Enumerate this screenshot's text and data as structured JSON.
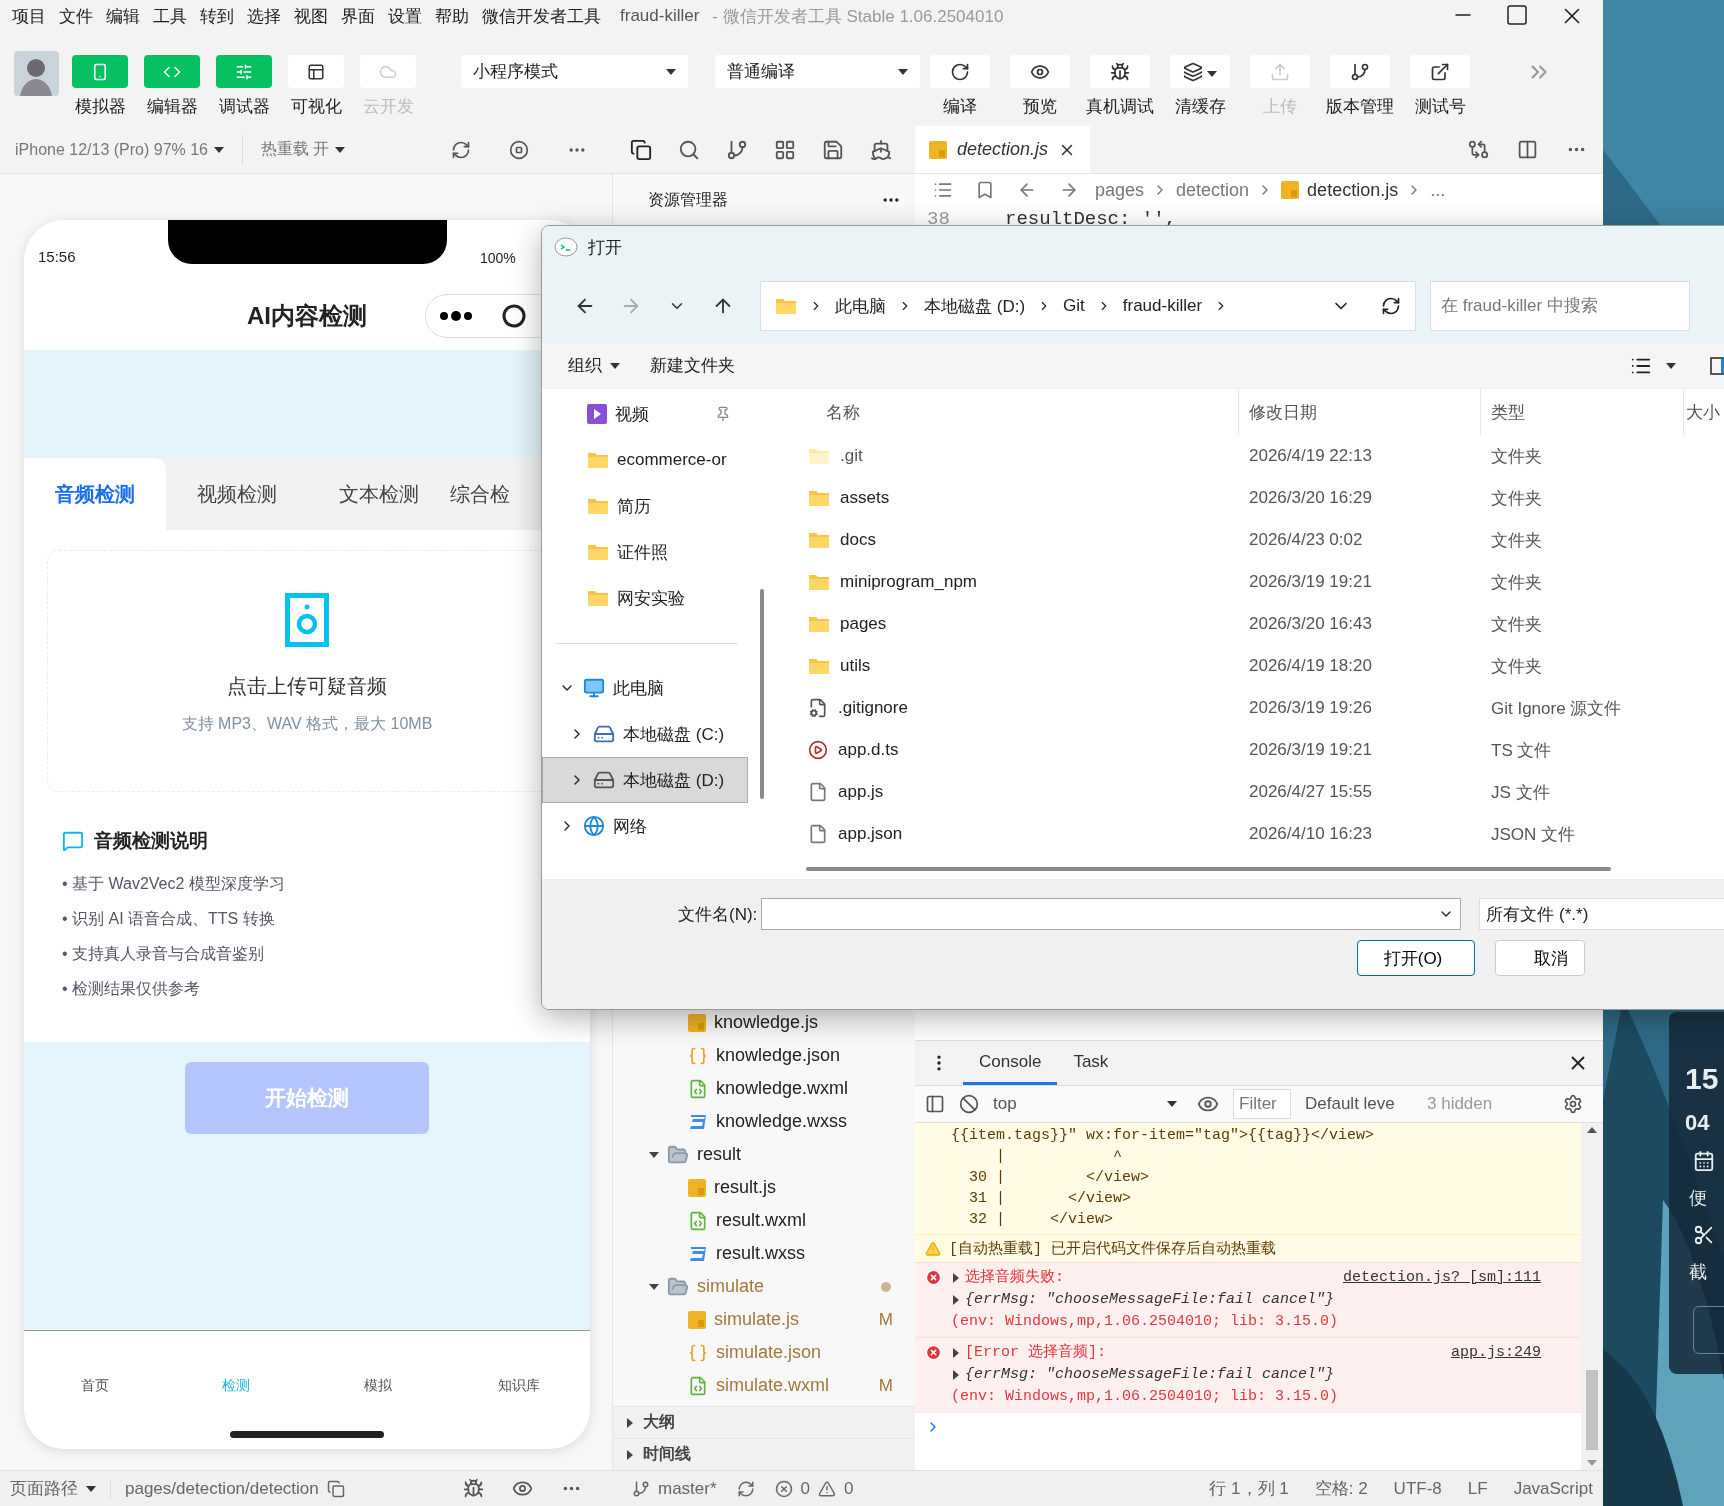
{
  "menu_bar": {
    "items": [
      "项目",
      "文件",
      "编辑",
      "工具",
      "转到",
      "选择",
      "视图",
      "界面",
      "设置",
      "帮助",
      "微信开发者工具"
    ],
    "title": "fraud-killer",
    "subtitle": "- 微信开发者工具 Stable 1.06.2504010"
  },
  "toolbar": {
    "view_buttons": [
      {
        "label": "模拟器",
        "on": true,
        "disabled": false
      },
      {
        "label": "编辑器",
        "on": true,
        "disabled": false
      },
      {
        "label": "调试器",
        "on": true,
        "disabled": false
      },
      {
        "label": "可视化",
        "on": false,
        "disabled": false
      },
      {
        "label": "云开发",
        "on": false,
        "disabled": true
      }
    ],
    "mode_select": "小程序模式",
    "compile_select": "普通编译",
    "actions": [
      {
        "label": "编译",
        "disabled": false
      },
      {
        "label": "预览",
        "disabled": false
      },
      {
        "label": "真机调试",
        "disabled": false
      },
      {
        "label": "清缓存",
        "disabled": false
      },
      {
        "label": "上传",
        "disabled": true
      },
      {
        "label": "版本管理",
        "disabled": false
      },
      {
        "label": "测试号",
        "disabled": false
      }
    ]
  },
  "simulator_bar": {
    "device": "iPhone 12/13 (Pro) 97% 16",
    "hot_reload": "热重载 开"
  },
  "editor": {
    "tab": "detection.js",
    "breadcrumb": [
      "pages",
      "detection",
      "detection.js",
      "..."
    ],
    "line_number": "38",
    "code": "resultDesc: '',"
  },
  "explorer": {
    "title": "资源管理器",
    "tree": [
      {
        "children": [
          {
            "name": "knowledge.js",
            "kind": "js",
            "modified": false
          },
          {
            "name": "knowledge.json",
            "kind": "json",
            "modified": false
          },
          {
            "name": "knowledge.wxml",
            "kind": "wxml",
            "modified": false
          },
          {
            "name": "knowledge.wxss",
            "kind": "wxss",
            "modified": false
          }
        ]
      },
      {
        "name": "result",
        "kind": "folder",
        "expanded": true,
        "modified": false,
        "children": [
          {
            "name": "result.js",
            "kind": "js",
            "modified": false
          },
          {
            "name": "result.wxml",
            "kind": "wxml",
            "modified": false
          },
          {
            "name": "result.wxss",
            "kind": "wxss",
            "modified": false
          }
        ]
      },
      {
        "name": "simulate",
        "kind": "folder",
        "expanded": true,
        "modified": true,
        "children": [
          {
            "name": "simulate.js",
            "kind": "js",
            "modified": true,
            "badge": "M"
          },
          {
            "name": "simulate.json",
            "kind": "json",
            "modified": true
          },
          {
            "name": "simulate.wxml",
            "kind": "wxml",
            "modified": true,
            "badge": "M"
          }
        ]
      }
    ],
    "sections": [
      {
        "label": "大纲",
        "expanded": false
      },
      {
        "label": "时间线",
        "expanded": false
      }
    ]
  },
  "phone": {
    "time": "15:56",
    "battery": "100%",
    "title": "AI内容检测",
    "tabs": [
      {
        "label": "音频检测",
        "selected": true
      },
      {
        "label": "视频检测",
        "selected": false
      },
      {
        "label": "文本检测",
        "selected": false
      },
      {
        "label": "综合检",
        "selected": false
      }
    ],
    "upload": {
      "title": "点击上传可疑音频",
      "hint": "支持 MP3、WAV 格式，最大 10MB"
    },
    "info": {
      "title": "音频检测说明",
      "items": [
        "• 基于 Wav2Vec2 模型深度学习",
        "• 识别 AI 语音合成、TTS 转换",
        "• 支持真人录音与合成音鉴别",
        "• 检测结果仅供参考"
      ]
    },
    "start_button": {
      "label": "开始检测",
      "disabled": true
    },
    "tab_bar": [
      {
        "label": "首页",
        "selected": false
      },
      {
        "label": "检测",
        "selected": true
      },
      {
        "label": "模拟",
        "selected": false
      },
      {
        "label": "知识库",
        "selected": false
      }
    ]
  },
  "console": {
    "tabs": [
      {
        "label": "Console",
        "selected": true
      },
      {
        "label": "Task",
        "selected": false
      }
    ],
    "context": "top",
    "filter_placeholder": "Filter",
    "levels": "Default leve",
    "hidden": "3 hidden",
    "code_frame": [
      "{{item.tags}}\" wx:for-item=\"tag\">{{tag}}</view>",
      "     |            ^",
      "  30 |         </view>",
      "  31 |       </view>",
      "  32 |     </view>"
    ],
    "warning": "[自动热重载] 已开启代码文件保存后自动热重载",
    "errors": [
      {
        "title": "选择音频失败:",
        "source": "detection.js? [sm]:111",
        "detail": "{errMsg: \"chooseMessageFile:fail cancel\"}",
        "env": "(env: Windows,mp,1.06.2504010; lib: 3.15.0)"
      },
      {
        "title": "[Error 选择音频]:",
        "source": "app.js:249",
        "detail": "{errMsg: \"chooseMessageFile:fail cancel\"}",
        "env": "(env: Windows,mp,1.06.2504010; lib: 3.15.0)"
      }
    ]
  },
  "status_bar": {
    "path_label": "页面路径",
    "path": "pages/detection/detection",
    "branch": "master*",
    "errors": "0",
    "warnings": "0",
    "info": [
      "行 1，列 1",
      "空格: 2",
      "UTF-8",
      "LF",
      "JavaScript"
    ]
  },
  "dialog": {
    "title": "打开",
    "path": [
      "此电脑",
      "本地磁盘 (D:)",
      "Git",
      "fraud-killer"
    ],
    "search_placeholder": "在 fraud-killer 中搜索",
    "commands": [
      "组织",
      "新建文件夹"
    ],
    "quick_access": [
      {
        "label": "视频",
        "kind": "video",
        "pinned": true
      },
      {
        "label": "ecommerce-or",
        "kind": "folder",
        "pinned": false
      },
      {
        "label": "简历",
        "kind": "folder",
        "pinned": false
      },
      {
        "label": "证件照",
        "kind": "folder",
        "pinned": false
      },
      {
        "label": "网安实验",
        "kind": "folder",
        "pinned": false
      }
    ],
    "tree": [
      {
        "label": "此电脑",
        "kind": "pc",
        "expanded": true,
        "selected": false,
        "children": [
          {
            "label": "本地磁盘 (C:)",
            "kind": "drive_c",
            "expanded": false,
            "selected": false
          },
          {
            "label": "本地磁盘 (D:)",
            "kind": "drive",
            "expanded": false,
            "selected": true
          }
        ]
      },
      {
        "label": "网络",
        "kind": "network",
        "expanded": false,
        "selected": false
      }
    ],
    "columns": [
      "名称",
      "修改日期",
      "类型",
      "大小"
    ],
    "files": [
      {
        "name": ".git",
        "date": "2026/4/19 22:13",
        "type": "文件夹",
        "kind": "folder",
        "hidden": true
      },
      {
        "name": "assets",
        "date": "2026/3/20 16:29",
        "type": "文件夹",
        "kind": "folder",
        "hidden": false
      },
      {
        "name": "docs",
        "date": "2026/4/23 0:02",
        "type": "文件夹",
        "kind": "folder",
        "hidden": false
      },
      {
        "name": "miniprogram_npm",
        "date": "2026/3/19 19:21",
        "type": "文件夹",
        "kind": "folder",
        "hidden": false
      },
      {
        "name": "pages",
        "date": "2026/3/20 16:43",
        "type": "文件夹",
        "kind": "folder",
        "hidden": false
      },
      {
        "name": "utils",
        "date": "2026/4/19 18:20",
        "type": "文件夹",
        "kind": "folder",
        "hidden": false
      },
      {
        "name": ".gitignore",
        "date": "2026/3/19 19:26",
        "type": "Git Ignore 源文件",
        "kind": "config",
        "hidden": false
      },
      {
        "name": "app.d.ts",
        "date": "2026/3/19 19:21",
        "type": "TS 文件",
        "kind": "media",
        "hidden": false
      },
      {
        "name": "app.js",
        "date": "2026/4/27 15:55",
        "type": "JS 文件",
        "kind": "file",
        "hidden": false
      },
      {
        "name": "app.json",
        "date": "2026/4/10 16:23",
        "type": "JSON 文件",
        "kind": "file",
        "hidden": false
      }
    ],
    "filename_label": "文件名(N):",
    "file_type": "所有文件 (*.*)",
    "buttons": [
      {
        "label": "打开(O)",
        "default": true
      },
      {
        "label": "取消",
        "default": false
      }
    ]
  },
  "desktop_widget": {
    "texts": [
      "15",
      "04",
      "便",
      "截"
    ]
  }
}
